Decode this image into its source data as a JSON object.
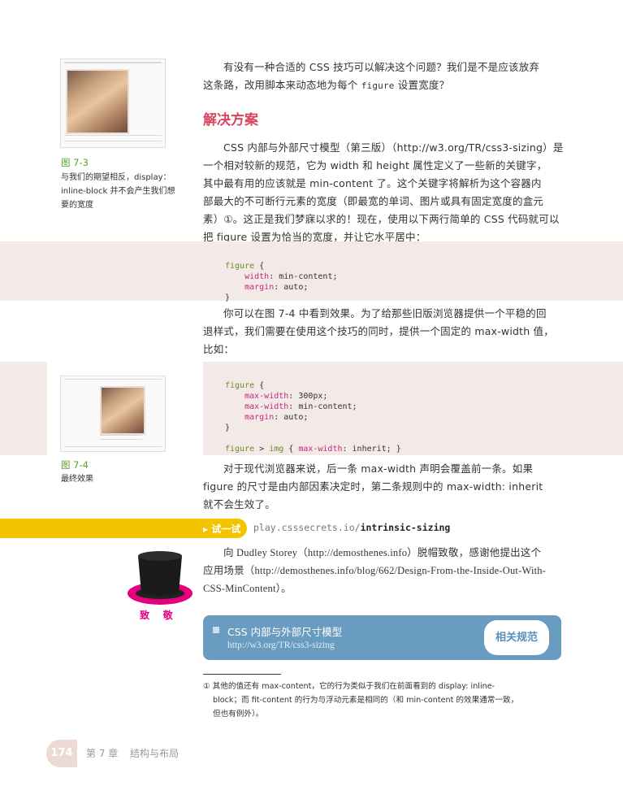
{
  "intro": {
    "line1_a": "有没有一种合适的 CSS 技巧可以解决这个问题？我们是不是应该放弃",
    "line2_a": "这条路，改用脚本来动态地为每个 ",
    "line2_code": "figure",
    "line2_b": " 设置宽度？"
  },
  "section_heading": "解决方案",
  "figure_7_3": {
    "number": "图 7-3",
    "caption_lines": [
      "与我们的期望相反，display：",
      "inline-block 并不会产生我们想",
      "要的宽度"
    ]
  },
  "para1": [
    "CSS 内部与外部尺寸模型（第三版）（http://w3.org/TR/css3-sizing）是",
    "一个相对较新的规范，它为 width 和 height 属性定义了一些新的关键字，",
    "其中最有用的应该就是 min-content 了。这个关键字将解析为这个容器内",
    "部最大的不可断行元素的宽度（即最宽的单词、图片或具有固定宽度的盒元",
    "素）①。这正是我们梦寐以求的！现在，使用以下两行简单的 CSS 代码就可以",
    "把 figure 设置为恰当的宽度，并让它水平居中："
  ],
  "code1": {
    "selector": "figure",
    "open": " {",
    "l1_prop": "width",
    "l1_val": ": min-content;",
    "l2_prop": "margin",
    "l2_val": ": auto;",
    "close": "}"
  },
  "para2": [
    "你可以在图 7-4 中看到效果。为了给那些旧版浏览器提供一个平稳的回",
    "退样式，我们需要在使用这个技巧的同时，提供一个固定的 max-width 值，",
    "比如："
  ],
  "code2": {
    "selector": "figure",
    "open": " {",
    "l1_prop": "max-width",
    "l1_val": ": 300px;",
    "l2_prop": "max-width",
    "l2_val": ": min-content;",
    "l3_prop": "margin",
    "l3_val": ": auto;",
    "close": "}",
    "rule2_sel1": "figure",
    "rule2_gt": " > ",
    "rule2_sel2": "img",
    "rule2_open": " { ",
    "rule2_prop": "max-width",
    "rule2_val": ": inherit; }"
  },
  "figure_7_4": {
    "number": "图 7-4",
    "caption": "最终效果"
  },
  "para3": [
    "对于现代浏览器来说，后一条 max-width 声明会覆盖前一条。如果",
    "figure 的尺寸是由内部因素决定时，第二条规则中的 max-width: inherit",
    "就不会生效了。"
  ],
  "try_it": {
    "label": "▸ 试一试",
    "url_prefix": "play.csssecrets.io/",
    "url_bold": "intrinsic-sizing"
  },
  "acknowledgement": {
    "label": "致    敬",
    "lines": [
      "向 Dudley Storey（http://demosthenes.info）脱帽致敬，感谢他提出这个",
      "应用场景（http://demosthenes.info/blog/662/Design-From-the-Inside-Out-With-",
      "CSS-MinContent）。"
    ]
  },
  "spec_box": {
    "title": "CSS 内部与外部尺寸模型",
    "url": "http://w3.org/TR/css3-sizing",
    "badge": "相关规范"
  },
  "footnote": {
    "lines": [
      "① 其他的值还有 max-content，它的行为类似于我们在前面看到的 display: inline-",
      "block；而 fit-content 的行为与浮动元素是相同的（和 min-content 的效果通常一致，",
      "但也有例外）。"
    ]
  },
  "footer": {
    "page_number": "174",
    "chapter": "第 7 章",
    "chapter_title": "结构与布局"
  },
  "colors": {
    "heading": "#d9455f",
    "caption_green": "#5aa02c",
    "code_bg": "#f3e9e7",
    "try_it_yellow": "#f5c400",
    "spec_blue": "#6a9cc2",
    "hat_pink": "#e6007e"
  }
}
